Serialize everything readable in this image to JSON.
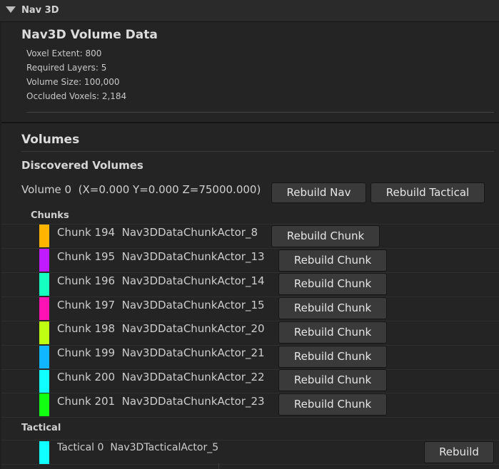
{
  "panel": {
    "title": "Nav 3D"
  },
  "volume_data": {
    "title": "Nav3D Volume Data",
    "stats": [
      "Voxel Extent: 800",
      "Required Layers: 5",
      "Volume Size: 100,000",
      "Occluded Voxels: 2,184"
    ]
  },
  "volumes": {
    "title": "Volumes",
    "discovered_title": "Discovered Volumes",
    "volume_label": "Volume 0  (X=0.000 Y=0.000 Z=75000.000)",
    "rebuild_nav": "Rebuild Nav",
    "rebuild_tactical": "Rebuild Tactical"
  },
  "chunks": {
    "title": "Chunks",
    "button_label": "Rebuild Chunk",
    "items": [
      {
        "label": "Chunk 194  Nav3DDataChunkActor_8",
        "color": "#ffb400"
      },
      {
        "label": "Chunk 195  Nav3DDataChunkActor_13",
        "color": "#c01aff"
      },
      {
        "label": "Chunk 196  Nav3DDataChunkActor_14",
        "color": "#14ffc0"
      },
      {
        "label": "Chunk 197  Nav3DDataChunkActor_15",
        "color": "#ff12b4"
      },
      {
        "label": "Chunk 198  Nav3DDataChunkActor_20",
        "color": "#bfff12"
      },
      {
        "label": "Chunk 199  Nav3DDataChunkActor_21",
        "color": "#10b6ff"
      },
      {
        "label": "Chunk 200  Nav3DDataChunkActor_22",
        "color": "#10ffff"
      },
      {
        "label": "Chunk 201  Nav3DDataChunkActor_23",
        "color": "#12ff12"
      }
    ]
  },
  "tactical": {
    "title": "Tactical",
    "items": [
      {
        "label": "Tactical 0  Nav3DTacticalActor_5",
        "color": "#10ffff"
      }
    ],
    "rebuild_label": "Rebuild"
  }
}
